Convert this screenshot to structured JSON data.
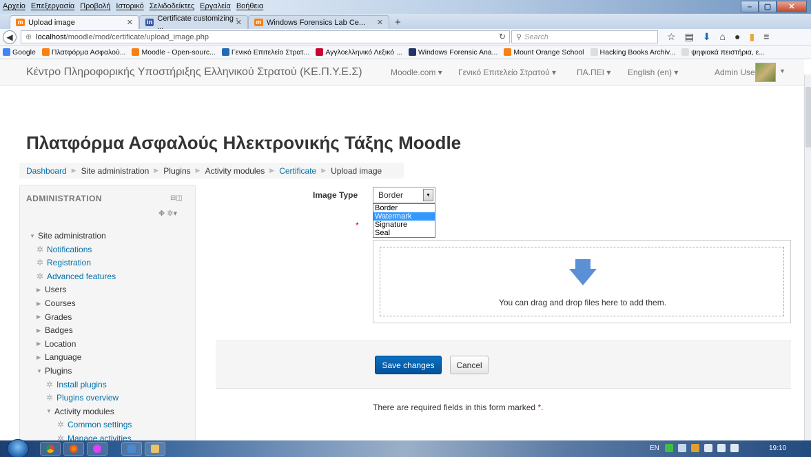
{
  "browser": {
    "menu": [
      "Αρχείο",
      "Επεξεργασία",
      "Προβολή",
      "Ιστορικό",
      "Σελιδοδείκτες",
      "Εργαλεία",
      "Βοήθεια"
    ],
    "tabs": [
      {
        "label": "Upload image",
        "icon_color": "#f98012"
      },
      {
        "label": "Certificate customizing - ...",
        "icon_color": "#3a5ca8"
      },
      {
        "label": "Windows Forensics Lab Ce...",
        "icon_color": "#f98012"
      }
    ],
    "url_host": "localhost",
    "url_path": "/moodle/mod/certificate/upload_image.php",
    "search_placeholder": "Search",
    "bookmarks": [
      {
        "label": "Google",
        "color": "#4285f4"
      },
      {
        "label": "Πλατφόρμα Ασφαλού...",
        "color": "#f98012"
      },
      {
        "label": "Moodle - Open-sourc...",
        "color": "#f98012"
      },
      {
        "label": "Γενικό Επιτελείο Στρατ...",
        "color": "#1e6bb8"
      },
      {
        "label": "Αγγλοελληνικό Λεξικό ...",
        "color": "#c03"
      },
      {
        "label": "Windows Forensic Ana...",
        "color": "#223366"
      },
      {
        "label": "Mount Orange School",
        "color": "#f98012"
      },
      {
        "label": "Hacking Books Archiv...",
        "color": "#ddd"
      },
      {
        "label": "ψηφιακά πειστήρια, ε...",
        "color": "#ddd"
      }
    ]
  },
  "site": {
    "name": "Κέντρο Πληροφορικής Υποστήριξης Ελληνικού Στρατού (ΚΕ.Π.Υ.Ε.Σ)",
    "menus": [
      "Moodle.com ▾",
      "Γενικό Επιτελείο Στρατού ▾",
      "ΠΑ.ΠΕΙ ▾",
      "English (en) ▾"
    ],
    "user": "Admin User"
  },
  "page": {
    "heading": "Πλατφόρμα Ασφαλούς Ηλεκτρονικής Τάξης Moodle",
    "breadcrumb": [
      {
        "label": "Dashboard",
        "link": true
      },
      {
        "label": "Site administration",
        "link": false
      },
      {
        "label": "Plugins",
        "link": false
      },
      {
        "label": "Activity modules",
        "link": false
      },
      {
        "label": "Certificate",
        "link": true
      },
      {
        "label": "Upload image",
        "link": false
      }
    ]
  },
  "admin": {
    "title": "ADMINISTRATION",
    "items": [
      {
        "label": "Site administration",
        "type": "expanded",
        "level": 0
      },
      {
        "label": "Notifications",
        "type": "gear",
        "level": 1
      },
      {
        "label": "Registration",
        "type": "gear",
        "level": 1
      },
      {
        "label": "Advanced features",
        "type": "gear",
        "level": 1
      },
      {
        "label": "Users",
        "type": "collapsed",
        "level": 1
      },
      {
        "label": "Courses",
        "type": "collapsed",
        "level": 1
      },
      {
        "label": "Grades",
        "type": "collapsed",
        "level": 1
      },
      {
        "label": "Badges",
        "type": "collapsed",
        "level": 1
      },
      {
        "label": "Location",
        "type": "collapsed",
        "level": 1
      },
      {
        "label": "Language",
        "type": "collapsed",
        "level": 1
      },
      {
        "label": "Plugins",
        "type": "expanded",
        "level": 1
      },
      {
        "label": "Install plugins",
        "type": "gear",
        "level": 2
      },
      {
        "label": "Plugins overview",
        "type": "gear",
        "level": 2
      },
      {
        "label": "Activity modules",
        "type": "expanded",
        "level": 2
      },
      {
        "label": "Common settings",
        "type": "gear",
        "level": 3
      },
      {
        "label": "Manage activities",
        "type": "gear",
        "level": 3
      }
    ]
  },
  "form": {
    "image_type_label": "Image Type",
    "image_type_value": "Border",
    "image_type_options": [
      "Border",
      "Watermark",
      "Signature",
      "Seal"
    ],
    "highlighted_option": "Watermark",
    "dropzone_text": "You can drag and drop files here to add them.",
    "save_label": "Save changes",
    "cancel_label": "Cancel",
    "required_note": "There are required fields in this form marked",
    "required_mark": "*"
  },
  "taskbar": {
    "lang": "EN",
    "clock": "19:10"
  }
}
